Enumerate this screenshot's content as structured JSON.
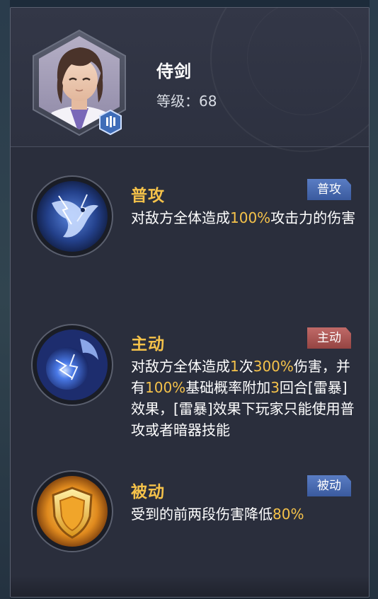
{
  "character": {
    "name": "侍剑",
    "level_text": "等级：68"
  },
  "skills": [
    {
      "title": "普攻",
      "badge": "普攻",
      "badge_color": "#4a6cb4",
      "desc_parts": [
        "对敌方全体造成",
        "100%",
        "攻击力的伤害"
      ]
    },
    {
      "title": "主动",
      "badge": "主动",
      "badge_color": "#a85654",
      "desc_parts": [
        "对敌方全体造成",
        "1",
        "次",
        "300%",
        "伤害，并有",
        "100%",
        "基础概率附加",
        "3",
        "回合[雷暴]效果，[雷暴]效果下玩家只能使用普攻或者暗器技能"
      ]
    },
    {
      "title": "被动",
      "badge": "被动",
      "badge_color": "#4a6cb4",
      "desc_parts": [
        "受到的前两段伤害降低",
        "80%"
      ]
    }
  ],
  "colors": {
    "highlight": "#f5c24a",
    "panel": "#2a2e3c"
  },
  "icons": {
    "avatar": "character-portrait",
    "class_badge": "class-emblem-icon",
    "skill_1": "lightning-eagle-icon",
    "skill_2": "lightning-orb-icon",
    "skill_3": "golden-shield-icon"
  }
}
